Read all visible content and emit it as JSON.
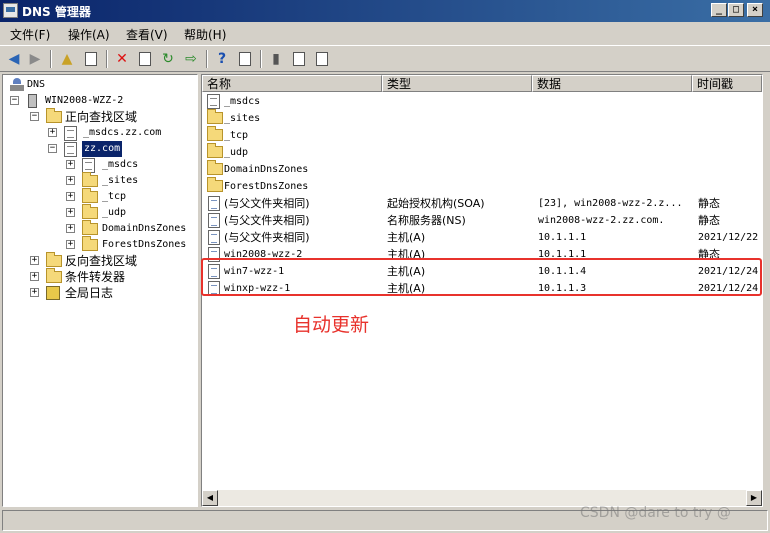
{
  "window": {
    "title": "DNS 管理器",
    "minimize": "_",
    "maximize": "□",
    "close": "×"
  },
  "menu": [
    "文件(F)",
    "操作(A)",
    "查看(V)",
    "帮助(H)"
  ],
  "tree": {
    "root": "DNS",
    "server": "WIN2008-WZZ-2",
    "forward_zones": "正向查找区域",
    "msdcs_zone": "_msdcs.zz.com",
    "zz_zone": "zz.com",
    "children": [
      "_msdcs",
      "_sites",
      "_tcp",
      "_udp",
      "DomainDnsZones",
      "ForestDnsZones"
    ],
    "reverse_zones": "反向查找区域",
    "conditional_forwarders": "条件转发器",
    "global_logs": "全局日志"
  },
  "columns": [
    "名称",
    "类型",
    "数据",
    "时间戳"
  ],
  "records": [
    {
      "name": "_msdcs",
      "type": "",
      "data": "",
      "timestamp": "",
      "icon": "zone-doc"
    },
    {
      "name": "_sites",
      "type": "",
      "data": "",
      "timestamp": "",
      "icon": "folder"
    },
    {
      "name": "_tcp",
      "type": "",
      "data": "",
      "timestamp": "",
      "icon": "folder"
    },
    {
      "name": "_udp",
      "type": "",
      "data": "",
      "timestamp": "",
      "icon": "folder"
    },
    {
      "name": "DomainDnsZones",
      "type": "",
      "data": "",
      "timestamp": "",
      "icon": "folder"
    },
    {
      "name": "ForestDnsZones",
      "type": "",
      "data": "",
      "timestamp": "",
      "icon": "folder"
    },
    {
      "name": "(与父文件夹相同)",
      "type": "起始授权机构(SOA)",
      "data": "[23], win2008-wzz-2.z...",
      "timestamp": "静态",
      "icon": "record"
    },
    {
      "name": "(与父文件夹相同)",
      "type": "名称服务器(NS)",
      "data": "win2008-wzz-2.zz.com.",
      "timestamp": "静态",
      "icon": "record"
    },
    {
      "name": "(与父文件夹相同)",
      "type": "主机(A)",
      "data": "10.1.1.1",
      "timestamp": "2021/12/22",
      "icon": "record"
    },
    {
      "name": "win2008-wzz-2",
      "type": "主机(A)",
      "data": "10.1.1.1",
      "timestamp": "静态",
      "icon": "record"
    },
    {
      "name": "win7-wzz-1",
      "type": "主机(A)",
      "data": "10.1.1.4",
      "timestamp": "2021/12/24",
      "icon": "record"
    },
    {
      "name": "winxp-wzz-1",
      "type": "主机(A)",
      "data": "10.1.1.3",
      "timestamp": "2021/12/24",
      "icon": "record"
    }
  ],
  "annotation": "自动更新",
  "watermark": "CSDN @dare to try @",
  "colors": {
    "title_bar": "#0a246a",
    "annotation": "#e8322c",
    "selection": "#0a246a"
  }
}
